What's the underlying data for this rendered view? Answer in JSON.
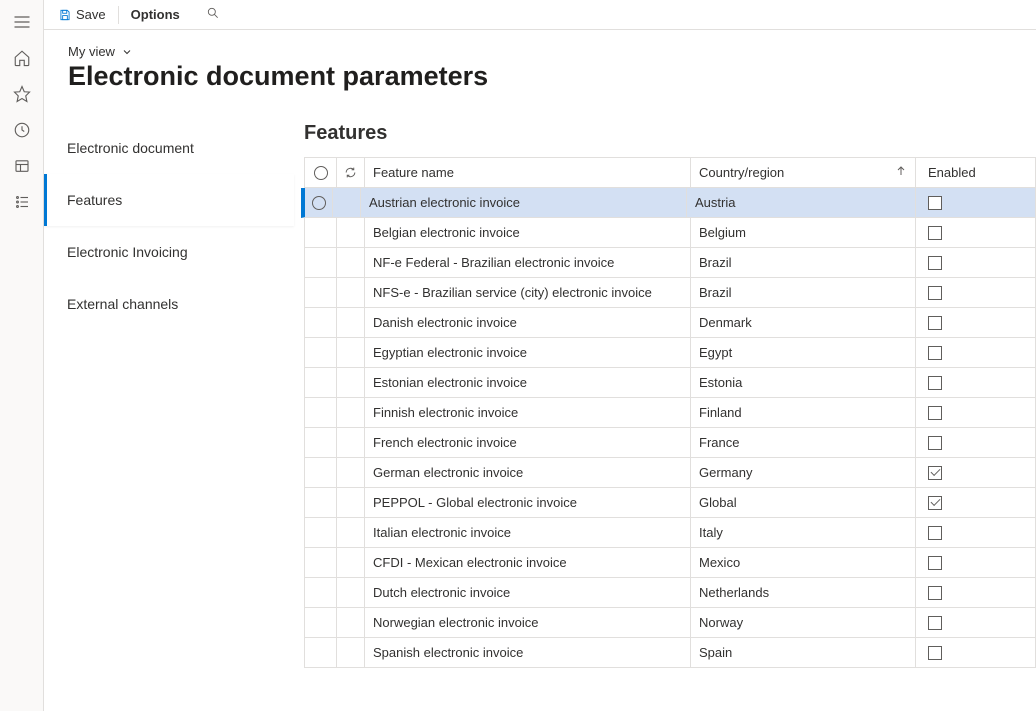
{
  "action_bar": {
    "save_label": "Save",
    "options_label": "Options"
  },
  "header": {
    "view_label": "My view",
    "title": "Electronic document parameters"
  },
  "side_tabs": {
    "items": [
      {
        "label": "Electronic document",
        "active": false
      },
      {
        "label": "Features",
        "active": true
      },
      {
        "label": "Electronic Invoicing",
        "active": false
      },
      {
        "label": "External channels",
        "active": false
      }
    ]
  },
  "panel": {
    "title": "Features",
    "columns": {
      "feature_name": "Feature name",
      "country": "Country/region",
      "enabled": "Enabled"
    },
    "rows": [
      {
        "name": "Austrian electronic invoice",
        "country": "Austria",
        "enabled": false,
        "selected": true
      },
      {
        "name": "Belgian electronic invoice",
        "country": "Belgium",
        "enabled": false,
        "selected": false
      },
      {
        "name": "NF-e  Federal - Brazilian electronic invoice",
        "country": "Brazil",
        "enabled": false,
        "selected": false
      },
      {
        "name": "NFS-e - Brazilian service (city) electronic invoice",
        "country": "Brazil",
        "enabled": false,
        "selected": false
      },
      {
        "name": "Danish electronic invoice",
        "country": "Denmark",
        "enabled": false,
        "selected": false
      },
      {
        "name": "Egyptian electronic invoice",
        "country": "Egypt",
        "enabled": false,
        "selected": false
      },
      {
        "name": "Estonian electronic invoice",
        "country": "Estonia",
        "enabled": false,
        "selected": false
      },
      {
        "name": "Finnish electronic invoice",
        "country": "Finland",
        "enabled": false,
        "selected": false
      },
      {
        "name": "French electronic invoice",
        "country": "France",
        "enabled": false,
        "selected": false
      },
      {
        "name": "German electronic invoice",
        "country": "Germany",
        "enabled": true,
        "selected": false
      },
      {
        "name": "PEPPOL - Global electronic invoice",
        "country": "Global",
        "enabled": true,
        "selected": false
      },
      {
        "name": "Italian electronic invoice",
        "country": "Italy",
        "enabled": false,
        "selected": false
      },
      {
        "name": "CFDI - Mexican electronic invoice",
        "country": "Mexico",
        "enabled": false,
        "selected": false
      },
      {
        "name": "Dutch electronic invoice",
        "country": "Netherlands",
        "enabled": false,
        "selected": false
      },
      {
        "name": "Norwegian electronic invoice",
        "country": "Norway",
        "enabled": false,
        "selected": false
      },
      {
        "name": "Spanish electronic invoice",
        "country": "Spain",
        "enabled": false,
        "selected": false
      }
    ]
  }
}
